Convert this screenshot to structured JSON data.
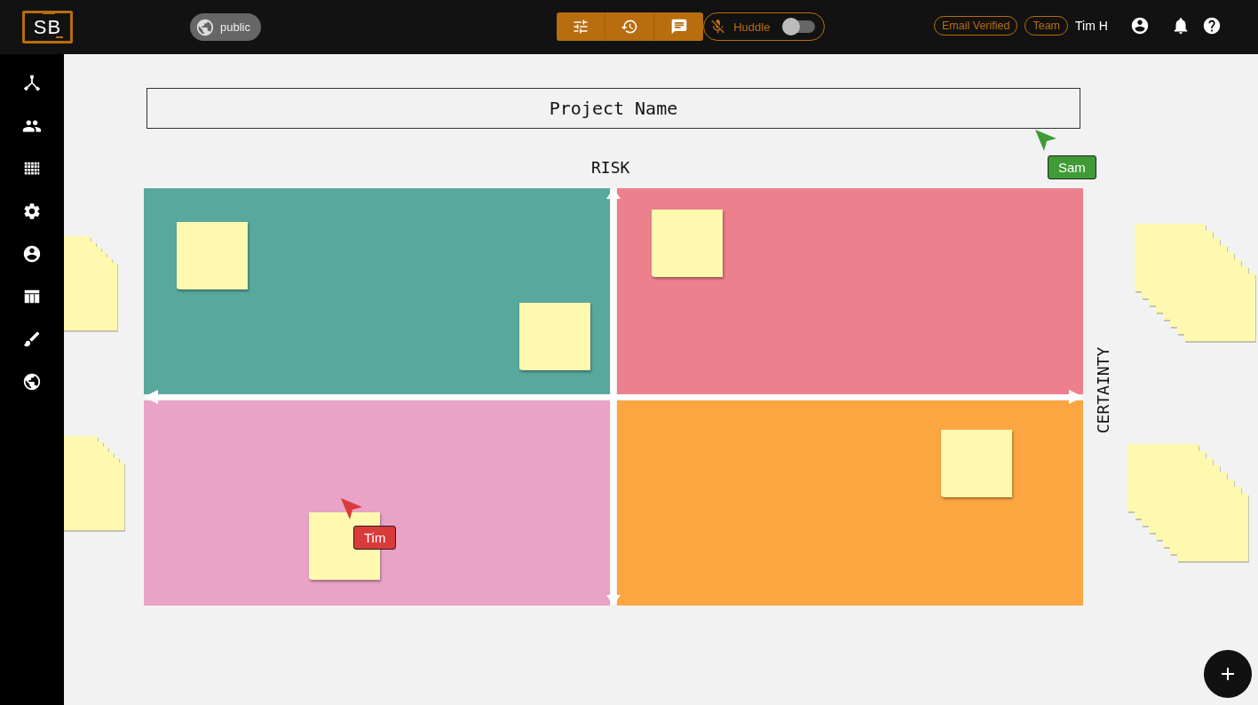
{
  "topbar": {
    "logo": "SB",
    "visibility": "public",
    "huddle": {
      "label": "Huddle",
      "on": false
    },
    "badges": [
      "Email Verified",
      "Team"
    ],
    "user": "Tim H"
  },
  "board": {
    "title": "Project Name",
    "vertical_axis_label": "RISK",
    "horizontal_axis_label": "CERTAINTY",
    "quadrants": [
      {
        "color": "#59a89d"
      },
      {
        "color": "#ec808c"
      },
      {
        "color": "#e8a3c6"
      },
      {
        "color": "#fca641"
      }
    ],
    "cursors": [
      {
        "name": "Sam",
        "color": "#3f9b35"
      },
      {
        "name": "Tim",
        "color": "#d93a3a"
      }
    ]
  }
}
